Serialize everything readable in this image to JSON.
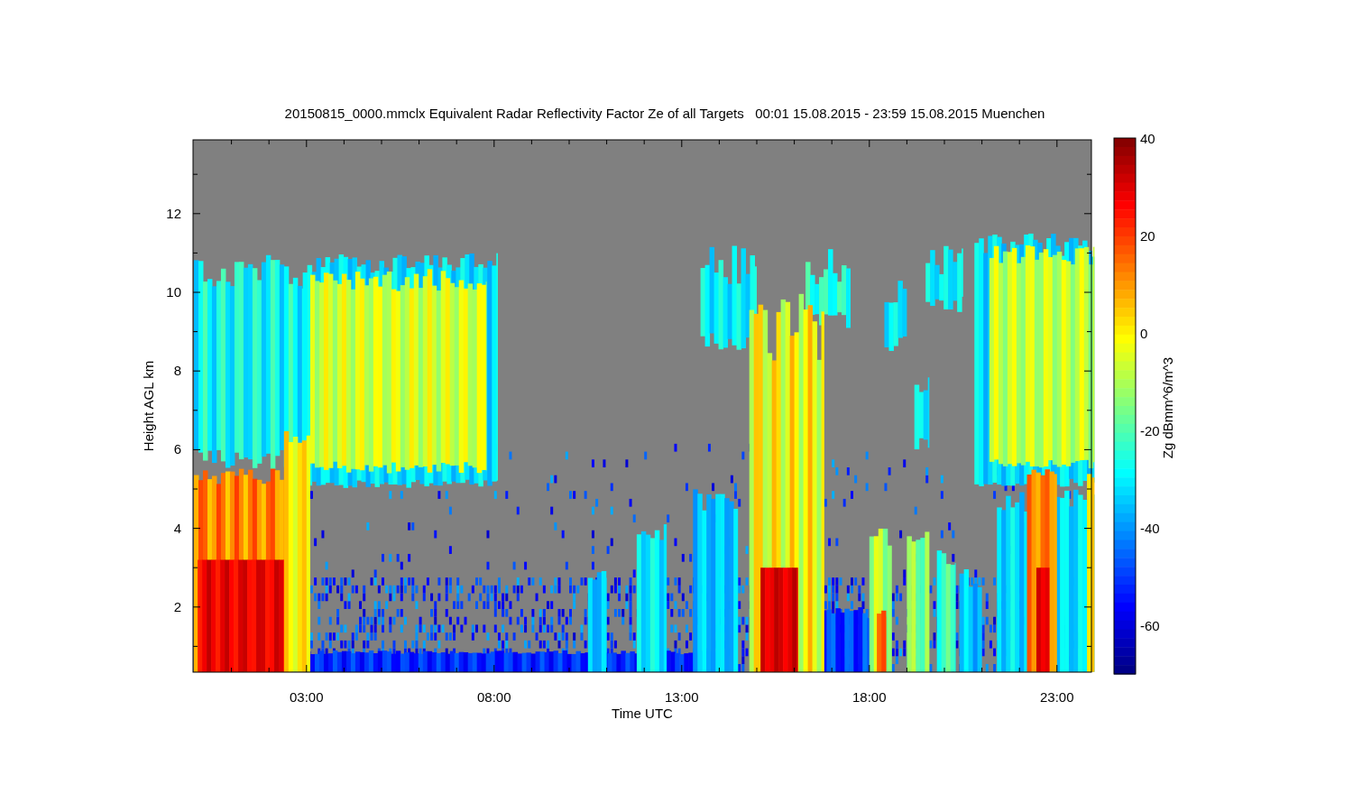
{
  "title": "20150815_0000.mmclx Equivalent Radar Reflectivity Factor Ze of all Targets   00:01 15.08.2015 - 23:59 15.08.2015 Muenchen",
  "plot": {
    "xlabel": "Time UTC",
    "ylabel": "Height AGL km",
    "xticks": [
      "03:00",
      "08:00",
      "13:00",
      "18:00",
      "23:00"
    ],
    "yticks": [
      "12",
      "10",
      "8",
      "6",
      "4",
      "2"
    ]
  },
  "colorbar": {
    "label": "Zg dBmm^6/m^3",
    "ticks": [
      "40",
      "20",
      "0",
      "-20",
      "-40",
      "-60"
    ]
  }
}
